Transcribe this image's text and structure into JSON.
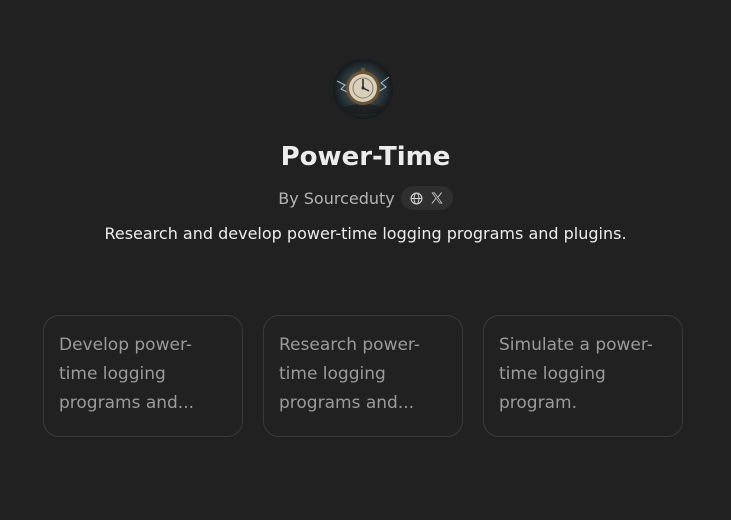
{
  "gpt": {
    "title": "Power-Time",
    "byline": "By Sourceduty",
    "description": "Research and develop power-time logging programs and plugins.",
    "avatar_icon": "clock-avatar-icon",
    "social_icons": [
      "globe-icon",
      "x-logo-icon"
    ]
  },
  "conversation_starters": [
    {
      "text": "Develop power-time logging programs and..."
    },
    {
      "text": "Research power-time logging programs and..."
    },
    {
      "text": "Simulate a power-time logging program."
    }
  ],
  "colors": {
    "background": "#212121",
    "card_border": "#3a3a3a",
    "pill_bg": "#2f2f2f",
    "text_primary": "#ececec",
    "text_secondary": "#b4b4b4",
    "text_muted": "#9b9b9b"
  }
}
